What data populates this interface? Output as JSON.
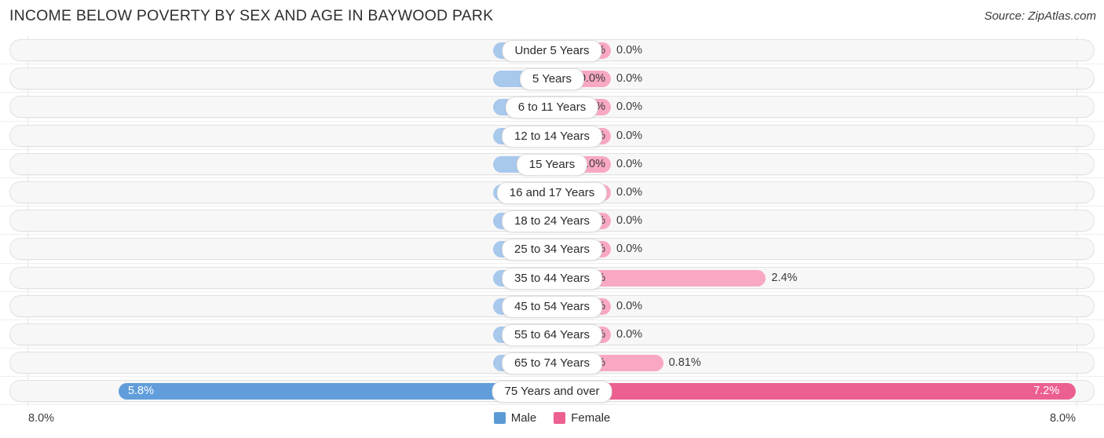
{
  "header": {
    "title": "INCOME BELOW POVERTY BY SEX AND AGE IN BAYWOOD PARK",
    "source": "Source: ZipAtlas.com"
  },
  "axis": {
    "left_label": "8.0%",
    "right_label": "8.0%"
  },
  "legend": {
    "items": [
      {
        "label": "Male",
        "color": "#5b9bd5"
      },
      {
        "label": "Female",
        "color": "#ec5f91"
      }
    ]
  },
  "colors": {
    "male_pale": "#a8c8ec",
    "female_pale": "#f9a8c4",
    "male_strong": "#619ddb",
    "female_strong": "#ec5f91",
    "track_fill": "#f7f7f7",
    "track_border": "#e2e2e2"
  },
  "chart_data": {
    "type": "bar",
    "orientation": "horizontal-diverging",
    "title": "INCOME BELOW POVERTY BY SEX AND AGE IN BAYWOOD PARK",
    "xlabel": "",
    "ylabel": "",
    "xlim": [
      8.0,
      8.0
    ],
    "grid": true,
    "legend_position": "bottom-center",
    "categories": [
      "Under 5 Years",
      "5 Years",
      "6 to 11 Years",
      "12 to 14 Years",
      "15 Years",
      "16 and 17 Years",
      "18 to 24 Years",
      "25 to 34 Years",
      "35 to 44 Years",
      "45 to 54 Years",
      "55 to 64 Years",
      "65 to 74 Years",
      "75 Years and over"
    ],
    "series": [
      {
        "name": "Male",
        "values": [
          0.0,
          0.0,
          0.0,
          0.0,
          0.0,
          0.0,
          0.0,
          0.0,
          0.0,
          0.0,
          0.0,
          0.0,
          5.8
        ],
        "labels": [
          "0.0%",
          "0.0%",
          "0.0%",
          "0.0%",
          "0.0%",
          "0.0%",
          "0.0%",
          "0.0%",
          "0.0%",
          "0.0%",
          "0.0%",
          "0.0%",
          "5.8%"
        ]
      },
      {
        "name": "Female",
        "values": [
          0.0,
          0.0,
          0.0,
          0.0,
          0.0,
          0.0,
          0.0,
          0.0,
          2.4,
          0.0,
          0.0,
          0.81,
          7.2
        ],
        "labels": [
          "0.0%",
          "0.0%",
          "0.0%",
          "0.0%",
          "0.0%",
          "0.0%",
          "0.0%",
          "0.0%",
          "2.4%",
          "0.0%",
          "0.0%",
          "0.81%",
          "7.2%"
        ]
      }
    ]
  }
}
